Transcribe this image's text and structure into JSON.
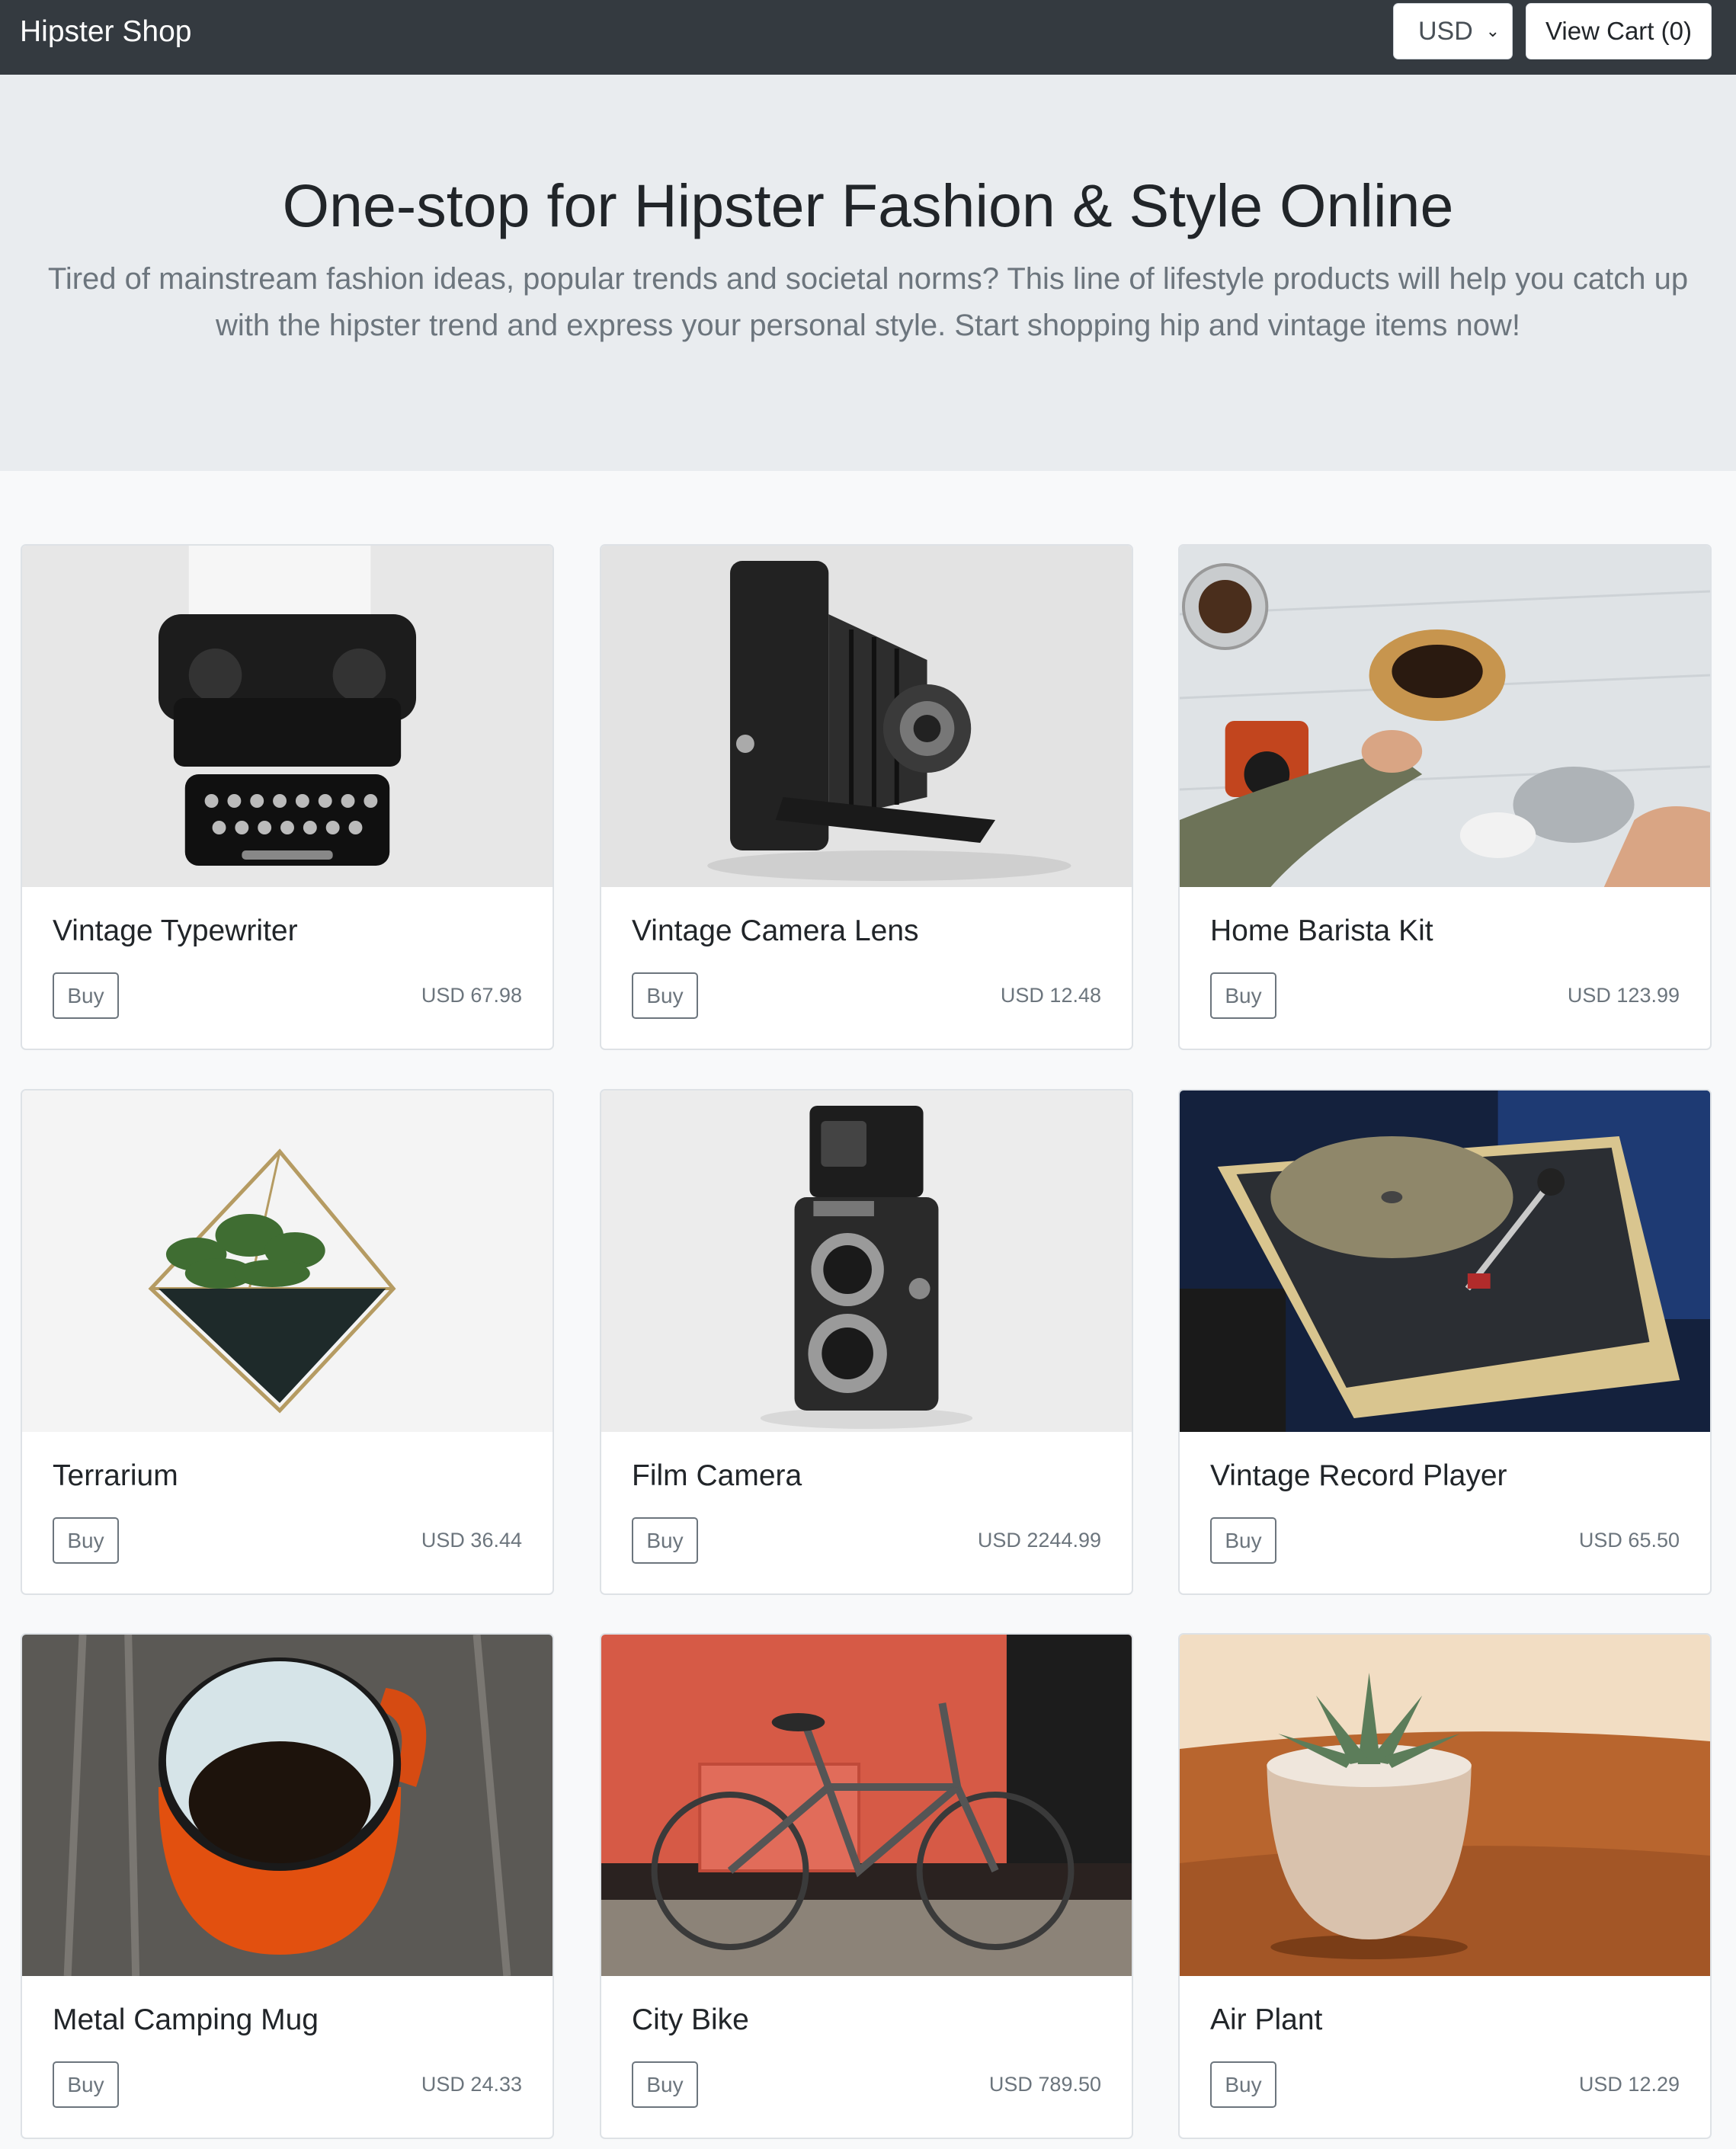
{
  "navbar": {
    "brand": "Hipster Shop",
    "currency": "USD",
    "cart_label": "View Cart (0)"
  },
  "hero": {
    "title": "One-stop for Hipster Fashion & Style Online",
    "text": "Tired of mainstream fashion ideas, popular trends and societal norms? This line of lifestyle products will help you catch up with the hipster trend and express your personal style. Start shopping hip and vintage items now!"
  },
  "products": [
    {
      "name": "Vintage Typewriter",
      "buy_label": "Buy",
      "price": "USD 67.98",
      "image": "typewriter-photo"
    },
    {
      "name": "Vintage Camera Lens",
      "buy_label": "Buy",
      "price": "USD 12.48",
      "image": "folding-camera-photo"
    },
    {
      "name": "Home Barista Kit",
      "buy_label": "Buy",
      "price": "USD 123.99",
      "image": "coffee-pour-over-photo"
    },
    {
      "name": "Terrarium",
      "buy_label": "Buy",
      "price": "USD 36.44",
      "image": "terrarium-photo"
    },
    {
      "name": "Film Camera",
      "buy_label": "Buy",
      "price": "USD 2244.99",
      "image": "twin-lens-camera-photo"
    },
    {
      "name": "Vintage Record Player",
      "buy_label": "Buy",
      "price": "USD 65.50",
      "image": "record-player-photo"
    },
    {
      "name": "Metal Camping Mug",
      "buy_label": "Buy",
      "price": "USD 24.33",
      "image": "enamel-mug-photo"
    },
    {
      "name": "City Bike",
      "buy_label": "Buy",
      "price": "USD 789.50",
      "image": "bicycle-photo"
    },
    {
      "name": "Air Plant",
      "buy_label": "Buy",
      "price": "USD 12.29",
      "image": "succulent-pot-photo"
    }
  ]
}
